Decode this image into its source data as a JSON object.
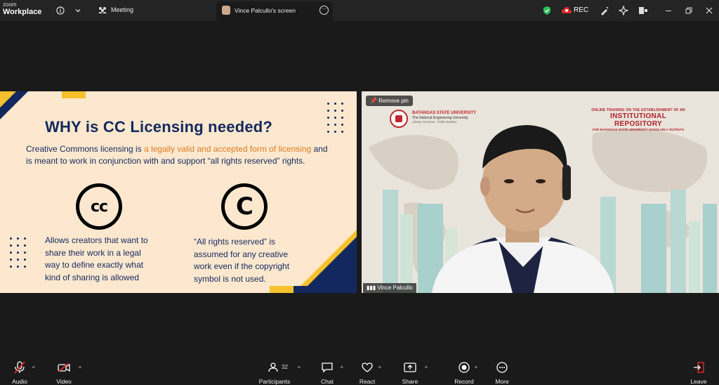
{
  "app": {
    "brand_top": "zoom",
    "brand_bottom": "Workplace"
  },
  "topbar": {
    "meeting_label": "Meeting",
    "screen_tab_label": "Vince Palcullo's screen",
    "rec_label": "REC"
  },
  "slide": {
    "title": "WHY is CC Licensing needed?",
    "para_a": "Creative Commons licensing is ",
    "para_highlight": "a legally valid and accepted form of licensing",
    "para_b": " and is meant to work in conjunction with and support “all rights reserved” rights.",
    "cc_icon_text": "cc",
    "copyright_icon_text": "C",
    "left_col": [
      "Allows creators that want to",
      "share their work in a legal",
      "way to define exactly what",
      "kind of sharing is allowed"
    ],
    "right_col": [
      "“All rights reserved” is",
      "assumed for any creative",
      "work even if the copyright",
      "symbol is not used."
    ]
  },
  "video": {
    "remove_pin": "Remove pin",
    "university_name": "BATANGAS STATE UNIVERSITY",
    "university_sub": "The National Engineering University",
    "university_sub2": "Library Services · Pablo Borbon",
    "training_line1": "ONLINE TRAINING ON THE ESTABLISHMENT OF AN",
    "training_line2": "INSTITUTIONAL REPOSITORY",
    "training_line3": "FOR BATANGAS STATE UNIVERSITY SCHOLARLY OUTPUTS",
    "participant_name": "Vince Palcullo"
  },
  "toolbar": {
    "audio": "Audio",
    "video": "Video",
    "participants": "Participants",
    "participants_count": "32",
    "chat": "Chat",
    "react": "React",
    "share": "Share",
    "record": "Record",
    "more": "More",
    "leave": "Leave"
  },
  "colors": {
    "slide_bg": "#fde8cf",
    "navy": "#13285e",
    "yellow": "#f7c12d",
    "highlight": "#e07a1f",
    "leave_red": "#e02828"
  }
}
